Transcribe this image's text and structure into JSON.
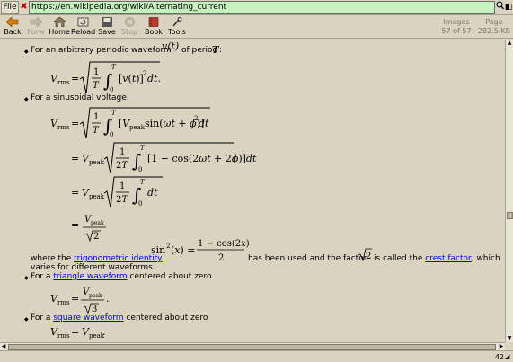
{
  "address_bar": {
    "file_label": "File",
    "stop_symbol": "✖",
    "url": "https://en.wikipedia.org/wiki/Alternating_current",
    "search_icon": "magnifier-icon",
    "go_symbol": "◧"
  },
  "toolbar": {
    "back": "Back",
    "forward": "Forw",
    "home": "Home",
    "reload": "Reload",
    "save": "Save",
    "stop": "Stop",
    "book": "Book",
    "tools": "Tools",
    "images_label": "Images",
    "images_value": "57 of 57",
    "page_label": "Page",
    "page_value": "282.5 KB"
  },
  "content": {
    "p1_prefix": "For an arbitrary periodic waveform",
    "p1_suffix": "of period",
    "p1_T": "T",
    "p1_colon": ":",
    "p1_v": "v(t)",
    "p2": "For a sinusoidal voltage:",
    "p3_where": "where the",
    "p3_link": "trigonometric identity",
    "p3_mid": "has been used and the factor",
    "p3_called": "is called the",
    "p3_link2": "crest factor",
    "p3_end": ", which",
    "p3_line2": "varies for different waveforms.",
    "p4_prefix": "For a",
    "p4_link": "triangle waveform",
    "p4_suffix": "centered about zero",
    "p5_prefix": "For a",
    "p5_link": "square waveform",
    "p5_suffix": "centered about zero"
  },
  "statusbar": {
    "zoom": "42"
  }
}
